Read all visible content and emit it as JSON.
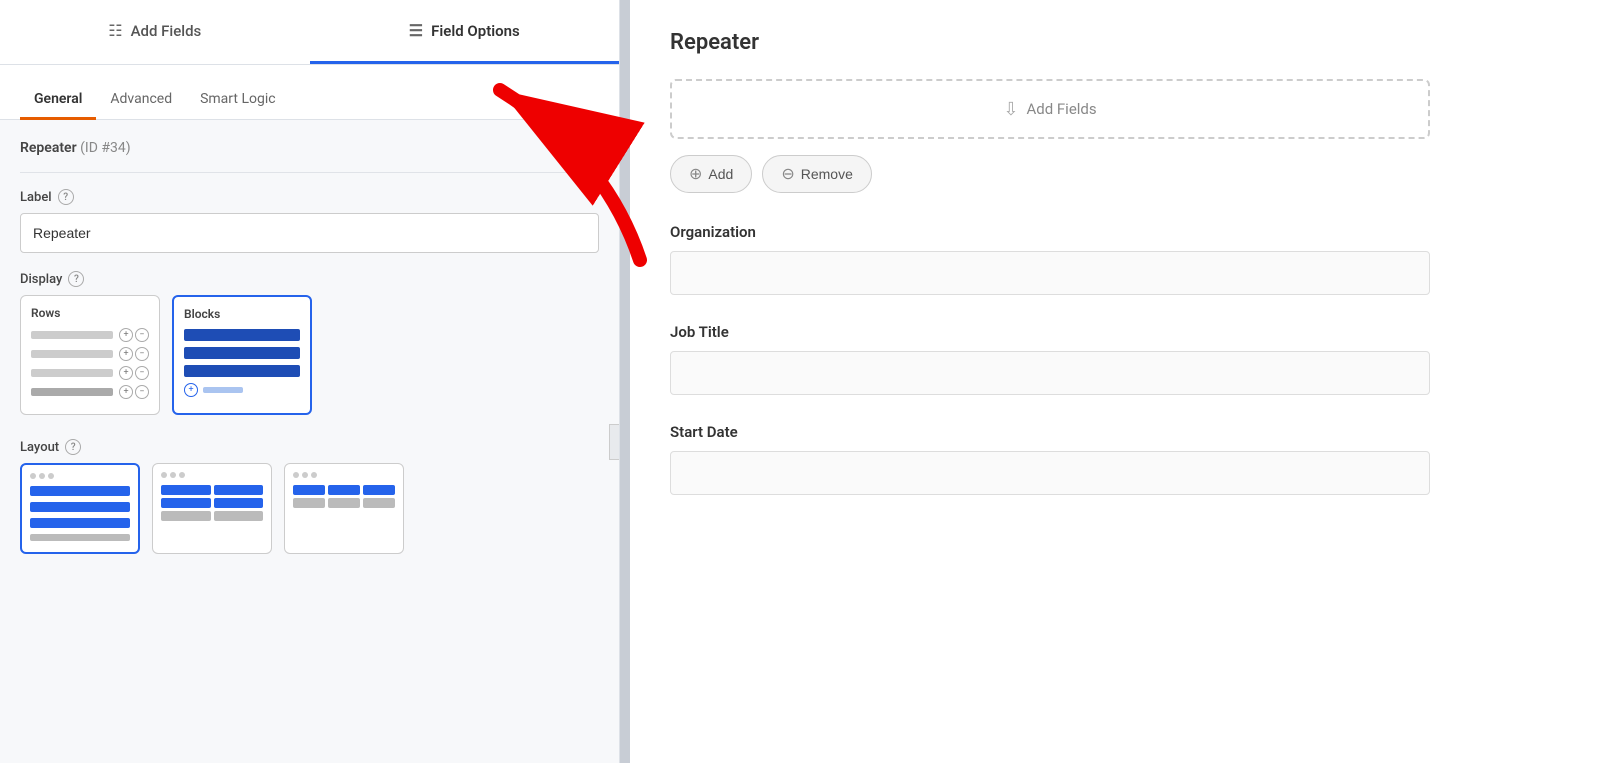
{
  "leftPanel": {
    "topTabs": [
      {
        "id": "add-fields",
        "label": "Add Fields",
        "icon": "⊞",
        "active": false
      },
      {
        "id": "field-options",
        "label": "Field Options",
        "icon": "⚙",
        "active": true
      }
    ],
    "subTabs": [
      {
        "id": "general",
        "label": "General",
        "active": true
      },
      {
        "id": "advanced",
        "label": "Advanced",
        "active": false
      },
      {
        "id": "smart-logic",
        "label": "Smart Logic",
        "active": false
      }
    ],
    "fieldTitle": "Repeater",
    "fieldId": "(ID #34)",
    "labelSection": {
      "label": "Label",
      "value": "Repeater"
    },
    "displaySection": {
      "title": "Display",
      "options": [
        {
          "id": "rows",
          "label": "Rows",
          "selected": false
        },
        {
          "id": "blocks",
          "label": "Blocks",
          "selected": true
        }
      ]
    },
    "layoutSection": {
      "title": "Layout",
      "options": [
        {
          "id": "layout-1",
          "selected": true
        },
        {
          "id": "layout-2",
          "selected": false
        },
        {
          "id": "layout-3",
          "selected": false
        }
      ]
    }
  },
  "rightPanel": {
    "title": "Repeater",
    "addFieldsPlaceholder": "Add Fields",
    "addButton": "Add",
    "removeButton": "Remove",
    "fields": [
      {
        "label": "Organization",
        "placeholder": ""
      },
      {
        "label": "Job Title",
        "placeholder": ""
      },
      {
        "label": "Start Date",
        "placeholder": ""
      }
    ]
  }
}
